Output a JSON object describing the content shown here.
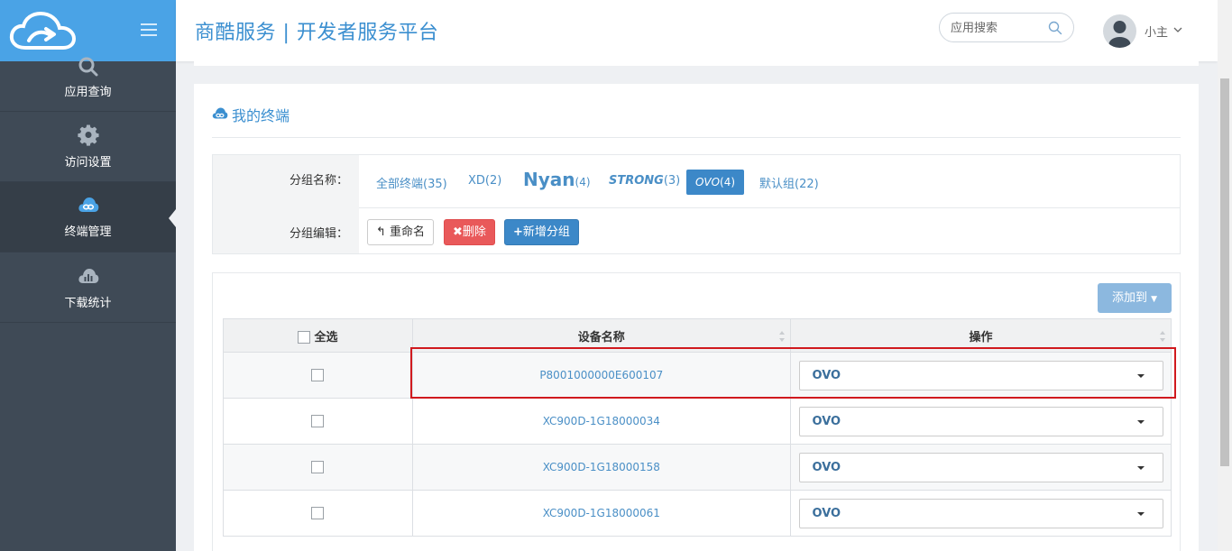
{
  "header": {
    "title": "商酷服务 | 开发者服务平台",
    "search_placeholder": "应用搜索",
    "user_name": "小主"
  },
  "sidebar": {
    "items": [
      {
        "label": "应用查询",
        "icon": "search-icon"
      },
      {
        "label": "访问设置",
        "icon": "gear-icon"
      },
      {
        "label": "终端管理",
        "icon": "cloud-link-icon",
        "active": true
      },
      {
        "label": "下载统计",
        "icon": "cloud-chart-icon"
      }
    ]
  },
  "panel": {
    "title": "我的终端",
    "group_name_label": "分组名称：",
    "group_edit_label": "分组编辑：",
    "tabs": [
      {
        "name": "全部终端",
        "count": "(35)"
      },
      {
        "name": "XD",
        "count": "(2)"
      },
      {
        "name": "Nyan",
        "count": "(4)"
      },
      {
        "name": "STRONG",
        "count": "(3)"
      },
      {
        "name": "OVO",
        "count": "(4)",
        "active": true
      },
      {
        "name": "默认组",
        "count": "(22)"
      }
    ],
    "buttons": {
      "rename": "重命名",
      "delete": "删除",
      "add_group": "新增分组"
    },
    "add_to": "添加到"
  },
  "table": {
    "headers": {
      "select_all": "全选",
      "device": "设备名称",
      "action": "操作"
    },
    "rows": [
      {
        "device": "P8001000000E600107",
        "group": "OVO"
      },
      {
        "device": "XC900D-1G18000034",
        "group": "OVO"
      },
      {
        "device": "XC900D-1G18000158",
        "group": "OVO"
      },
      {
        "device": "XC900D-1G18000061",
        "group": "OVO"
      }
    ]
  },
  "colors": {
    "sidebar": "#3f4a56",
    "logo_bar": "#4aa3e6",
    "accent": "#3c88c8",
    "danger": "#e9595a",
    "highlight": "#d0191e"
  }
}
